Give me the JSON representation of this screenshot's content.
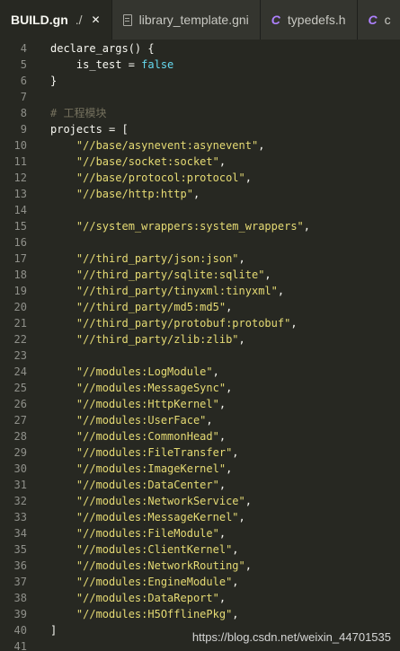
{
  "tabs": [
    {
      "name": "BUILD.gn",
      "dir": "./",
      "close": "✕",
      "active": true,
      "icon": "none"
    },
    {
      "name": "library_template.gni",
      "active": false,
      "icon": "doc-icon"
    },
    {
      "name": "typedefs.h",
      "active": false,
      "icon": "c-icon",
      "icon_text": "C"
    },
    {
      "name": "c",
      "active": false,
      "icon": "c-icon",
      "icon_text": "C"
    }
  ],
  "lines": [
    {
      "n": "4",
      "segs": [
        {
          "t": "declare_args",
          "c": "fn"
        },
        {
          "t": "() {",
          "c": "plain"
        }
      ]
    },
    {
      "n": "5",
      "segs": [
        {
          "t": "    is_test = ",
          "c": "plain"
        },
        {
          "t": "false",
          "c": "kw"
        }
      ]
    },
    {
      "n": "6",
      "segs": [
        {
          "t": "}",
          "c": "plain"
        }
      ]
    },
    {
      "n": "7",
      "segs": []
    },
    {
      "n": "8",
      "segs": [
        {
          "t": "# 工程模块",
          "c": "com"
        }
      ]
    },
    {
      "n": "9",
      "segs": [
        {
          "t": "projects = [",
          "c": "plain"
        }
      ]
    },
    {
      "n": "10",
      "segs": [
        {
          "t": "    ",
          "c": "plain"
        },
        {
          "t": "\"//base/asynevent:asynevent\"",
          "c": "str"
        },
        {
          "t": ",",
          "c": "plain"
        }
      ]
    },
    {
      "n": "11",
      "segs": [
        {
          "t": "    ",
          "c": "plain"
        },
        {
          "t": "\"//base/socket:socket\"",
          "c": "str"
        },
        {
          "t": ",",
          "c": "plain"
        }
      ]
    },
    {
      "n": "12",
      "segs": [
        {
          "t": "    ",
          "c": "plain"
        },
        {
          "t": "\"//base/protocol:protocol\"",
          "c": "str"
        },
        {
          "t": ",",
          "c": "plain"
        }
      ]
    },
    {
      "n": "13",
      "segs": [
        {
          "t": "    ",
          "c": "plain"
        },
        {
          "t": "\"//base/http:http\"",
          "c": "str"
        },
        {
          "t": ",",
          "c": "plain"
        }
      ]
    },
    {
      "n": "14",
      "segs": []
    },
    {
      "n": "15",
      "segs": [
        {
          "t": "    ",
          "c": "plain"
        },
        {
          "t": "\"//system_wrappers:system_wrappers\"",
          "c": "str"
        },
        {
          "t": ",",
          "c": "plain"
        }
      ]
    },
    {
      "n": "16",
      "segs": []
    },
    {
      "n": "17",
      "segs": [
        {
          "t": "    ",
          "c": "plain"
        },
        {
          "t": "\"//third_party/json:json\"",
          "c": "str"
        },
        {
          "t": ",",
          "c": "plain"
        }
      ]
    },
    {
      "n": "18",
      "segs": [
        {
          "t": "    ",
          "c": "plain"
        },
        {
          "t": "\"//third_party/sqlite:sqlite\"",
          "c": "str"
        },
        {
          "t": ",",
          "c": "plain"
        }
      ]
    },
    {
      "n": "19",
      "segs": [
        {
          "t": "    ",
          "c": "plain"
        },
        {
          "t": "\"//third_party/tinyxml:tinyxml\"",
          "c": "str"
        },
        {
          "t": ",",
          "c": "plain"
        }
      ]
    },
    {
      "n": "20",
      "segs": [
        {
          "t": "    ",
          "c": "plain"
        },
        {
          "t": "\"//third_party/md5:md5\"",
          "c": "str"
        },
        {
          "t": ",",
          "c": "plain"
        }
      ]
    },
    {
      "n": "21",
      "segs": [
        {
          "t": "    ",
          "c": "plain"
        },
        {
          "t": "\"//third_party/protobuf:protobuf\"",
          "c": "str"
        },
        {
          "t": ",",
          "c": "plain"
        }
      ]
    },
    {
      "n": "22",
      "segs": [
        {
          "t": "    ",
          "c": "plain"
        },
        {
          "t": "\"//third_party/zlib:zlib\"",
          "c": "str"
        },
        {
          "t": ",",
          "c": "plain"
        }
      ]
    },
    {
      "n": "23",
      "segs": []
    },
    {
      "n": "24",
      "segs": [
        {
          "t": "    ",
          "c": "plain"
        },
        {
          "t": "\"//modules:LogModule\"",
          "c": "str"
        },
        {
          "t": ",",
          "c": "plain"
        }
      ]
    },
    {
      "n": "25",
      "segs": [
        {
          "t": "    ",
          "c": "plain"
        },
        {
          "t": "\"//modules:MessageSync\"",
          "c": "str"
        },
        {
          "t": ",",
          "c": "plain"
        }
      ]
    },
    {
      "n": "26",
      "segs": [
        {
          "t": "    ",
          "c": "plain"
        },
        {
          "t": "\"//modules:HttpKernel\"",
          "c": "str"
        },
        {
          "t": ",",
          "c": "plain"
        }
      ]
    },
    {
      "n": "27",
      "segs": [
        {
          "t": "    ",
          "c": "plain"
        },
        {
          "t": "\"//modules:UserFace\"",
          "c": "str"
        },
        {
          "t": ",",
          "c": "plain"
        }
      ]
    },
    {
      "n": "28",
      "segs": [
        {
          "t": "    ",
          "c": "plain"
        },
        {
          "t": "\"//modules:CommonHead\"",
          "c": "str"
        },
        {
          "t": ",",
          "c": "plain"
        }
      ]
    },
    {
      "n": "29",
      "segs": [
        {
          "t": "    ",
          "c": "plain"
        },
        {
          "t": "\"//modules:FileTransfer\"",
          "c": "str"
        },
        {
          "t": ",",
          "c": "plain"
        }
      ]
    },
    {
      "n": "30",
      "segs": [
        {
          "t": "    ",
          "c": "plain"
        },
        {
          "t": "\"//modules:ImageKernel\"",
          "c": "str"
        },
        {
          "t": ",",
          "c": "plain"
        }
      ]
    },
    {
      "n": "31",
      "segs": [
        {
          "t": "    ",
          "c": "plain"
        },
        {
          "t": "\"//modules:DataCenter\"",
          "c": "str"
        },
        {
          "t": ",",
          "c": "plain"
        }
      ]
    },
    {
      "n": "32",
      "segs": [
        {
          "t": "    ",
          "c": "plain"
        },
        {
          "t": "\"//modules:NetworkService\"",
          "c": "str"
        },
        {
          "t": ",",
          "c": "plain"
        }
      ]
    },
    {
      "n": "33",
      "segs": [
        {
          "t": "    ",
          "c": "plain"
        },
        {
          "t": "\"//modules:MessageKernel\"",
          "c": "str"
        },
        {
          "t": ",",
          "c": "plain"
        }
      ]
    },
    {
      "n": "34",
      "segs": [
        {
          "t": "    ",
          "c": "plain"
        },
        {
          "t": "\"//modules:FileModule\"",
          "c": "str"
        },
        {
          "t": ",",
          "c": "plain"
        }
      ]
    },
    {
      "n": "35",
      "segs": [
        {
          "t": "    ",
          "c": "plain"
        },
        {
          "t": "\"//modules:ClientKernel\"",
          "c": "str"
        },
        {
          "t": ",",
          "c": "plain"
        }
      ]
    },
    {
      "n": "36",
      "segs": [
        {
          "t": "    ",
          "c": "plain"
        },
        {
          "t": "\"//modules:NetworkRouting\"",
          "c": "str"
        },
        {
          "t": ",",
          "c": "plain"
        }
      ]
    },
    {
      "n": "37",
      "segs": [
        {
          "t": "    ",
          "c": "plain"
        },
        {
          "t": "\"//modules:EngineModule\"",
          "c": "str"
        },
        {
          "t": ",",
          "c": "plain"
        }
      ]
    },
    {
      "n": "38",
      "segs": [
        {
          "t": "    ",
          "c": "plain"
        },
        {
          "t": "\"//modules:DataReport\"",
          "c": "str"
        },
        {
          "t": ",",
          "c": "plain"
        }
      ]
    },
    {
      "n": "39",
      "segs": [
        {
          "t": "    ",
          "c": "plain"
        },
        {
          "t": "\"//modules:H5OfflinePkg\"",
          "c": "str"
        },
        {
          "t": ",",
          "c": "plain"
        }
      ]
    },
    {
      "n": "40",
      "segs": [
        {
          "t": "]",
          "c": "plain"
        }
      ]
    },
    {
      "n": "41",
      "segs": []
    }
  ],
  "watermark": "https://blog.csdn.net/weixin_44701535",
  "colors": {
    "background": "#272822",
    "string": "#e6db74",
    "keyword": "#66d9ef",
    "comment": "#75715e",
    "line_number": "#8f908a"
  }
}
